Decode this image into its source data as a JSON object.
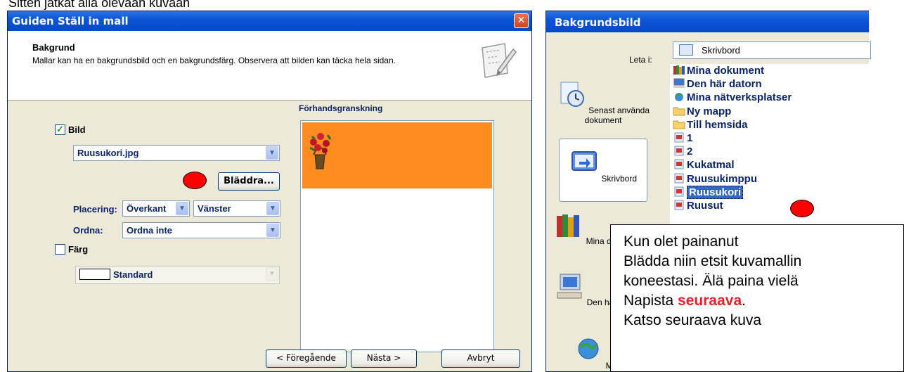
{
  "caption": "Sitten jatkat alla olevaan kuvaan",
  "wizard": {
    "title": "Guiden Ställ in mall",
    "close_symbol": "✕",
    "header_title": "Bakgrund",
    "header_desc": "Mallar kan ha en bakgrundsbild och en bakgrundsfärg. Observera att bilden kan täcka hela sidan.",
    "image_checkbox_label": "Bild",
    "image_checked": true,
    "image_file": "Ruusukori.jpg",
    "browse_label": "Bläddra...",
    "placement_label": "Placering:",
    "placement_vertical": "Överkant",
    "placement_horizontal": "Vänster",
    "arrange_label": "Ordna:",
    "arrange_value": "Ordna inte",
    "color_checkbox_label": "Färg",
    "color_checked": false,
    "color_value": "Standard",
    "preview_label": "Förhandsgranskning",
    "back_label": "< Föregående",
    "next_label": "Nästa >",
    "cancel_label": "Avbryt",
    "colors": {
      "preview_band": "#ff8c1f",
      "marker": "#ff0000"
    }
  },
  "file_dialog": {
    "title": "Bakgrundsbild",
    "look_in_label": "Leta i:",
    "look_in_value": "Skrivbord",
    "places": [
      {
        "label": "Senast använda dokument",
        "icon": "recent-documents-icon"
      },
      {
        "label": "Skrivbord",
        "icon": "desktop-icon"
      },
      {
        "label": "Mina dokument",
        "icon": "my-documents-icon"
      },
      {
        "label": "Den här datorn",
        "icon": "my-computer-icon"
      },
      {
        "label": "Mina nätverksplatser",
        "icon": "network-places-icon"
      }
    ],
    "files": [
      {
        "name": "Mina dokument",
        "icon": "my-documents-icon"
      },
      {
        "name": "Den här datorn",
        "icon": "my-computer-icon"
      },
      {
        "name": "Mina nätverksplatser",
        "icon": "network-places-icon"
      },
      {
        "name": "Ny mapp",
        "icon": "folder-icon"
      },
      {
        "name": "Till hemsida",
        "icon": "folder-icon"
      },
      {
        "name": "1",
        "icon": "image-file-icon"
      },
      {
        "name": "2",
        "icon": "image-file-icon"
      },
      {
        "name": "Kukatmal",
        "icon": "image-file-icon"
      },
      {
        "name": "Ruusukimppu",
        "icon": "image-file-icon"
      },
      {
        "name": "Ruusukori",
        "icon": "image-file-icon",
        "selected": true
      },
      {
        "name": "Ruusut",
        "icon": "image-file-icon"
      }
    ]
  },
  "callout": {
    "line1": "Kun olet painanut",
    "line2": "Blädda niin etsit kuvamallin",
    "line3": "koneestasi. Älä paina vielä",
    "line4_prefix": "Napista ",
    "line4_highlight": "seuraava",
    "line4_suffix": ".",
    "line5": "Katso seuraava kuva"
  }
}
